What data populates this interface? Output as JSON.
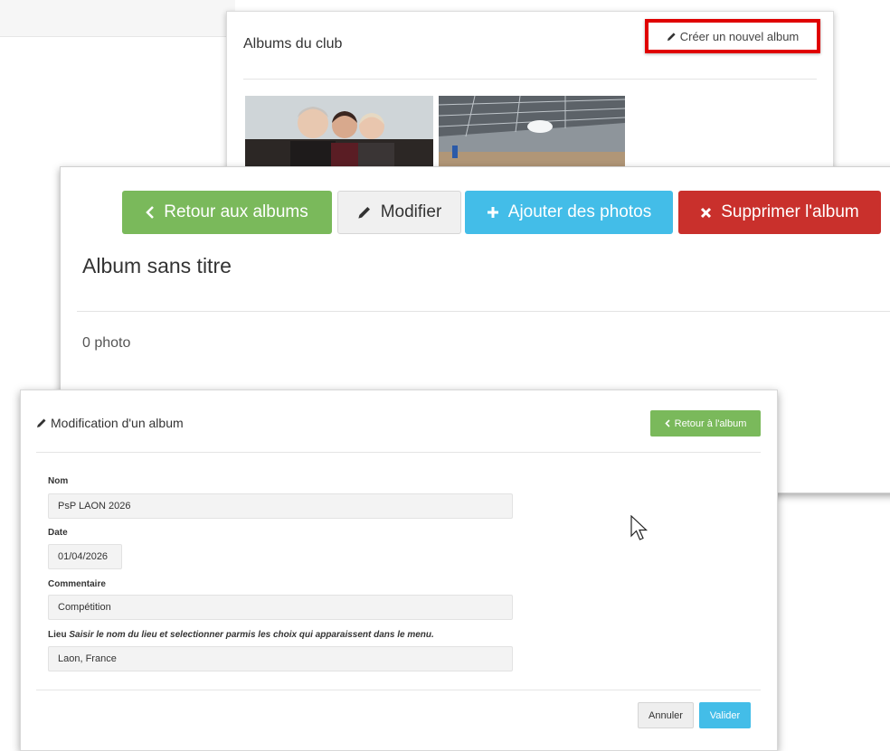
{
  "albums_panel": {
    "title": "Albums du club",
    "create_label": "Créer un nouvel album"
  },
  "album_panel": {
    "back_label": "Retour aux albums",
    "edit_label": "Modifier",
    "add_label": "Ajouter des photos",
    "delete_label": "Supprimer l'album",
    "title": "Album sans titre",
    "photo_count": "0 photo"
  },
  "edit_panel": {
    "title": "Modification d'un album",
    "back_label": "Retour à l'album",
    "fields": {
      "nom": {
        "label": "Nom",
        "value": "PsP LAON 2026"
      },
      "date": {
        "label": "Date",
        "value": "01/04/2026"
      },
      "commentaire": {
        "label": "Commentaire",
        "value": "Compétition"
      },
      "lieu": {
        "label": "Lieu",
        "hint": "Saisir le nom du lieu et selectionner parmis les choix qui apparaissent dans le menu.",
        "value": "Laon, France"
      }
    },
    "cancel_label": "Annuler",
    "submit_label": "Valider"
  },
  "colors": {
    "green": "#7ab95b",
    "blue": "#43bde8",
    "red": "#c9302c",
    "highlight": "#e00000"
  },
  "icons": [
    "pencil-icon",
    "chevron-left-icon",
    "plus-icon",
    "times-icon",
    "mouse-cursor-icon"
  ]
}
